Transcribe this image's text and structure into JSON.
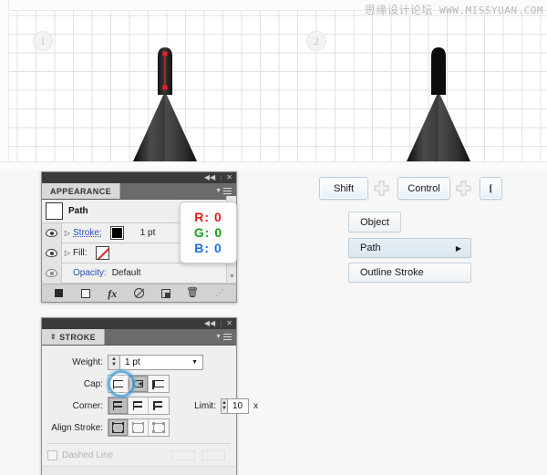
{
  "watermark": {
    "cn": "思缘设计论坛",
    "url": "WWW.MISSYUAN.COM"
  },
  "artboard": {
    "badges": [
      {
        "label": "1"
      },
      {
        "label": "2"
      }
    ],
    "illustrations": [
      {
        "name": "pen-with-selected-path",
        "path_color": "#ee1c2a"
      },
      {
        "name": "pen-with-outlined-stroke"
      }
    ]
  },
  "appearance_panel": {
    "tab_label": "APPEARANCE",
    "collapse_icon": "collapse-icon",
    "close_icon": "close-icon",
    "menu_icon": "panel-menu-icon",
    "title": "Path",
    "rows": [
      {
        "label": "Stroke:",
        "value": "1 pt",
        "swatch": "black",
        "has_eye": true,
        "has_triangle": true
      },
      {
        "label": "Fill:",
        "value": "",
        "swatch": "none",
        "has_eye": true,
        "has_triangle": true
      },
      {
        "label": "Opacity:",
        "value": "Default",
        "swatch": "",
        "has_eye": true,
        "has_triangle": false
      }
    ],
    "footer_icons": [
      "add-new-stroke-icon",
      "add-new-fill-icon",
      "add-new-effect-icon",
      "clear-appearance-icon",
      "duplicate-item-icon",
      "delete-item-icon",
      "resize-grip-icon"
    ]
  },
  "rgb_tooltip": {
    "r_label": "R:",
    "r_value": "0",
    "g_label": "G:",
    "g_value": "0",
    "b_label": "B:",
    "b_value": "0",
    "r_color": "#e01b1b",
    "g_color": "#18a018",
    "b_color": "#1b6fe0"
  },
  "stroke_panel": {
    "tab_label": "STROKE",
    "collapse_icon": "collapse-icon",
    "close_icon": "close-icon",
    "menu_icon": "panel-menu-icon",
    "weight": {
      "label": "Weight:",
      "value": "1 pt"
    },
    "cap": {
      "label": "Cap:",
      "options": [
        "butt-cap",
        "round-cap",
        "projecting-cap"
      ],
      "selected_index": 1,
      "highlighted": true
    },
    "corner": {
      "label": "Corner:",
      "options": [
        "miter-join",
        "round-join",
        "bevel-join"
      ],
      "selected_index": 0
    },
    "limit": {
      "label": "Limit:",
      "value": "10",
      "unit": "x"
    },
    "align_stroke": {
      "label": "Align Stroke:",
      "options": [
        "align-center",
        "align-inside",
        "align-outside"
      ],
      "selected_index": 0
    },
    "dashed_line": {
      "label": "Dashed Line",
      "checked": false
    }
  },
  "shortcut": {
    "keys": [
      {
        "label": "Shift"
      },
      {
        "label": "Control"
      },
      {
        "label": "["
      }
    ],
    "separator_icon": "plus-icon"
  },
  "menu": {
    "items": [
      {
        "label": "Object",
        "has_submenu": false,
        "highlighted": false
      },
      {
        "label": "Path",
        "has_submenu": true,
        "highlighted": true
      },
      {
        "label": "Outline Stroke",
        "has_submenu": false,
        "highlighted": false
      }
    ],
    "submenu_arrow_icon": "caret-right-icon"
  }
}
